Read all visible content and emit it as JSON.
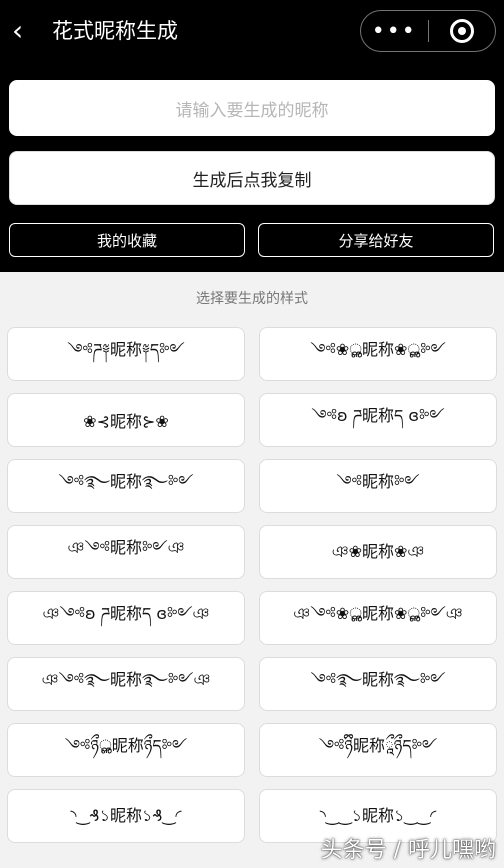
{
  "header": {
    "back_icon": "chevron-left-icon",
    "title": "花式昵称生成",
    "menu_icon": "more-dots-icon",
    "close_icon": "target-circle-icon"
  },
  "input": {
    "placeholder": "请输入要生成的昵称"
  },
  "actions": {
    "generate_label": "生成后点我复制",
    "favorites_label": "我的收藏",
    "share_label": "分享给好友"
  },
  "styles": {
    "section_title": "选择要生成的样式",
    "items": [
      {
        "label": "༺ཌ༈昵称༈ད༻"
      },
      {
        "label": "༺❀ൢ昵称❀ൢ༻"
      },
      {
        "label": "❀⊰昵称⊱❀"
      },
      {
        "label": "༺ʚ ཌ昵称ད ɞ༻"
      },
      {
        "label": "༺࿐昵称࿐༻"
      },
      {
        "label": "༺昵称༻"
      },
      {
        "label": "ঞ༺昵称༻ঞ"
      },
      {
        "label": "ঞ❀昵称❀ঞ"
      },
      {
        "label": "ঞ༺ʚ ཌ昵称ད ɞ༻ঞ"
      },
      {
        "label": "ঞ༺❀ൢ昵称❀ൢ༻ঞ"
      },
      {
        "label": "ঞ༺࿐昵称࿐༻ঞ"
      },
      {
        "label": "༺࿐昵称࿐༻"
      },
      {
        "label": "༺ཉྀൢ昵称ཉྀད༻"
      },
      {
        "label": "༺ཉྀི昵称ཱྀཉྀད༻"
      },
      {
        "label": "◝‿₰১昵称১₰‿◜"
      },
      {
        "label": "◝‿‿১昵称১‿‿◜"
      }
    ]
  },
  "watermark": "头条号 / 呼儿嘿哟"
}
